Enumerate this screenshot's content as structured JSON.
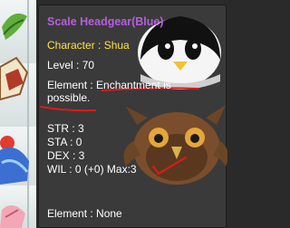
{
  "tooltip": {
    "item_name": "Scale Headgear(Blue)",
    "character": "Character : Shua",
    "level": "Level : 70",
    "element_line1": "Element : Enchantment is",
    "element_line2": "possible.",
    "stats": {
      "str": "STR : 3",
      "sta": "STA : 0",
      "dex": "DEX : 3",
      "wil": "WIL : 0 (+0) Max:3"
    },
    "element_footer": "Element : None"
  },
  "colors": {
    "tooltip_bg": "#3a3a3a",
    "item_name": "#b55ee0",
    "character_text": "#ffe24a",
    "body_text": "#ffffff",
    "annotation_red": "#e01919"
  }
}
